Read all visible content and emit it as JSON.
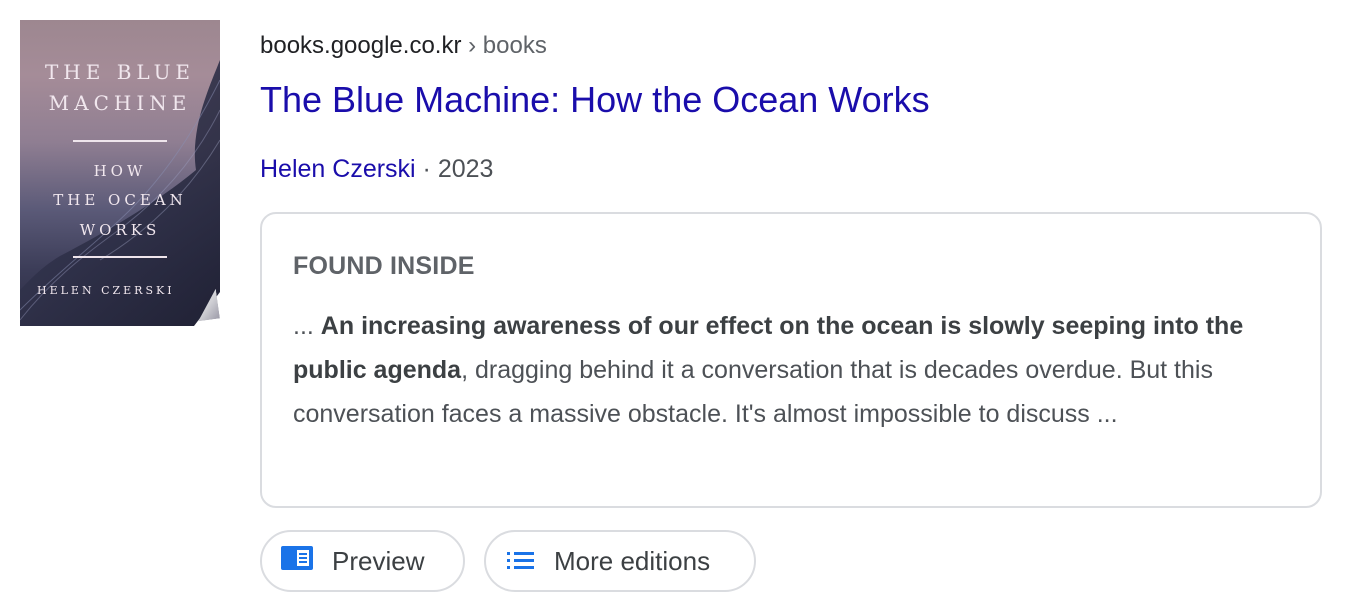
{
  "book": {
    "cover": {
      "title_line_1": "THE BLUE",
      "title_line_2": "MACHINE",
      "subtitle_line_1": "HOW",
      "subtitle_line_2": "THE OCEAN",
      "subtitle_line_3": "WORKS",
      "author": "HELEN CZERSKI"
    }
  },
  "result": {
    "domain": "books.google.co.kr",
    "path": " › books",
    "title": "The Blue Machine: How the Ocean Works",
    "author": "Helen Czerski",
    "separator": " · ",
    "year": "2023"
  },
  "found_inside": {
    "label": "FOUND INSIDE",
    "prefix": "... ",
    "highlight": "An increasing awareness of our effect on the ocean is slowly seeping into the public agenda",
    "rest": ", dragging behind it a conversation that is decades overdue. But this conversation faces a massive obstacle. It's almost impossible to discuss ..."
  },
  "actions": {
    "preview_label": "Preview",
    "more_editions_label": "More editions"
  },
  "colors": {
    "link": "#1a0dab",
    "icon_blue": "#1a73e8",
    "border": "#dadce0",
    "muted_text": "#5f6368"
  },
  "icons": {
    "preview": "book-preview-icon",
    "more_editions": "list-icon"
  }
}
